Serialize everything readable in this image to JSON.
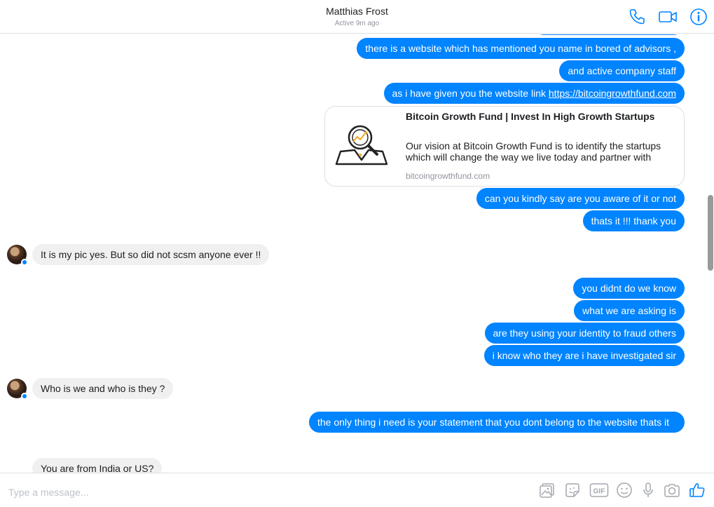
{
  "header": {
    "contact_name": "Matthias Frost",
    "status": "Active 9m ago",
    "icons": [
      "phone-icon",
      "video-camera-icon",
      "info-icon"
    ]
  },
  "messages": [
    {
      "from": "me",
      "text": "there is a website which has mentioned you name in bored of advisors ,"
    },
    {
      "from": "me",
      "text": "and active company staff"
    },
    {
      "from": "me",
      "text": "as i have given you the website link ",
      "link": "https://bitcoingrowthfund.com"
    },
    {
      "from": "me",
      "text": "can you kindly say are you aware of it or not"
    },
    {
      "from": "me",
      "text": "thats it !!! thank you"
    },
    {
      "from": "them",
      "text": "It is my pic yes. But so did not scsm anyone ever !!"
    },
    {
      "from": "me",
      "text": "you didnt do we know"
    },
    {
      "from": "me",
      "text": "what we are asking is"
    },
    {
      "from": "me",
      "text": "are they using your identity to fraud others"
    },
    {
      "from": "me",
      "text": "i know who they are i have investigated sir"
    },
    {
      "from": "them",
      "text": "Who is we and who is they ?"
    },
    {
      "from": "me",
      "text": "the only thing i need is your statement that you dont belong to the website thats it"
    },
    {
      "from": "them",
      "text": "You are from India or US?"
    }
  ],
  "link_preview": {
    "title": "Bitcoin Growth Fund | Invest In High Growth Startups",
    "description": "Our vision at Bitcoin Growth Fund is to identify the startups which will change the way we live today and partner with",
    "domain": "bitcoingrowthfund.com",
    "thumbnail_icon": "magnifier-growth-chart-icon"
  },
  "composer": {
    "placeholder": "Type a message...",
    "icons": [
      "image-icon",
      "sticker-icon",
      "gif-icon",
      "emoji-icon",
      "microphone-icon",
      "camera-icon",
      "thumbs-up-icon"
    ],
    "gif_label": "GIF"
  },
  "colors": {
    "outgoing_bubble": "#0084ff",
    "incoming_bubble": "#f1f0f0",
    "accent": "#0084ff"
  }
}
